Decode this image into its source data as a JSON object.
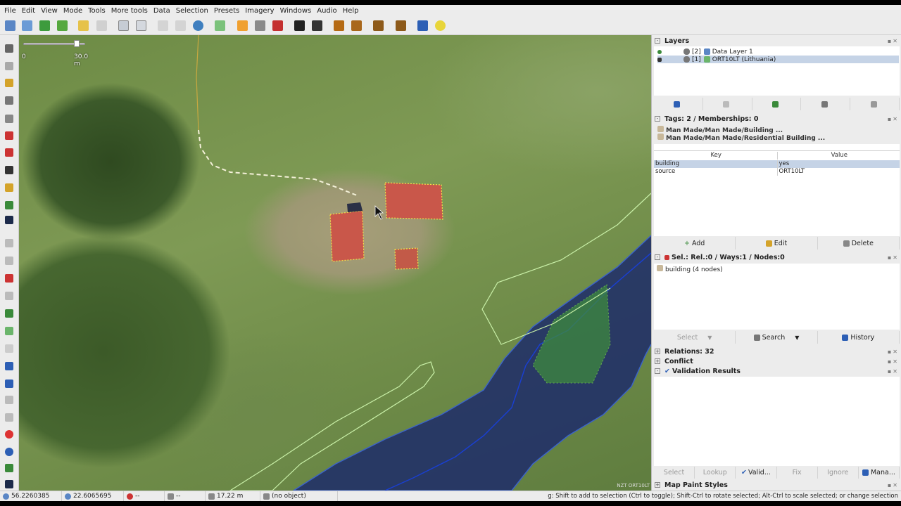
{
  "menu": [
    "File",
    "Edit",
    "View",
    "Mode",
    "Tools",
    "More tools",
    "Data",
    "Selection",
    "Presets",
    "Imagery",
    "Windows",
    "Audio",
    "Help"
  ],
  "toolbar": {
    "icons": [
      "new-file-icon",
      "open-file-icon",
      "download-icon",
      "upload-icon",
      "undo-icon",
      "redo-icon",
      "preferences-icon",
      "zoom-icon",
      "relation-icon",
      "wireframe-icon",
      "refresh-icon",
      "imagery-icon",
      "barrier-icon",
      "railway-icon",
      "warning-sign-icon",
      "car-icon",
      "bus-icon",
      "poi-icon",
      "food-icon",
      "industrial-icon",
      "chart-icon",
      "square-icon",
      "sun-icon"
    ]
  },
  "map": {
    "scale_min": "0",
    "scale_max": "30.0 m",
    "attribution": "NZT ORT10LT"
  },
  "layers": {
    "title": "Layers",
    "items": [
      {
        "index": "[2]",
        "name": "Data Layer 1"
      },
      {
        "index": "[1]",
        "name": "ORT10LT (Lithuania)"
      }
    ]
  },
  "tags": {
    "title": "Tags: 2 / Memberships: 0",
    "presets": [
      "Man Made/Man Made/Building ...",
      "Man Made/Man Made/Residential Building ..."
    ],
    "key_header": "Key",
    "value_header": "Value",
    "rows": [
      {
        "key": "building",
        "value": "yes"
      },
      {
        "key": "source",
        "value": "ORT10LT"
      }
    ],
    "add": "Add",
    "edit": "Edit",
    "delete": "Delete"
  },
  "selection": {
    "title": "Sel.: Rel.:0 / Ways:1 / Nodes:0",
    "item": "building (4 nodes)",
    "select": "Select",
    "search": "Search",
    "history": "History"
  },
  "relations": {
    "title": "Relations: 32"
  },
  "conflict": {
    "title": "Conflict"
  },
  "validation": {
    "title": "Validation Results",
    "buttons": [
      "Select",
      "Lookup",
      "Valid...",
      "Fix",
      "Ignore",
      "Mana..."
    ]
  },
  "mapstyles": {
    "title": "Map Paint Styles"
  },
  "status": {
    "lat": "56.2260385",
    "lon": "22.6065695",
    "heading": "--",
    "angle": "--",
    "distance": "17.22 m",
    "object": "(no object)",
    "help": "g: Shift to add to selection (Ctrl to toggle); Shift-Ctrl to rotate selected; Alt-Ctrl to scale selected; or change selection"
  }
}
